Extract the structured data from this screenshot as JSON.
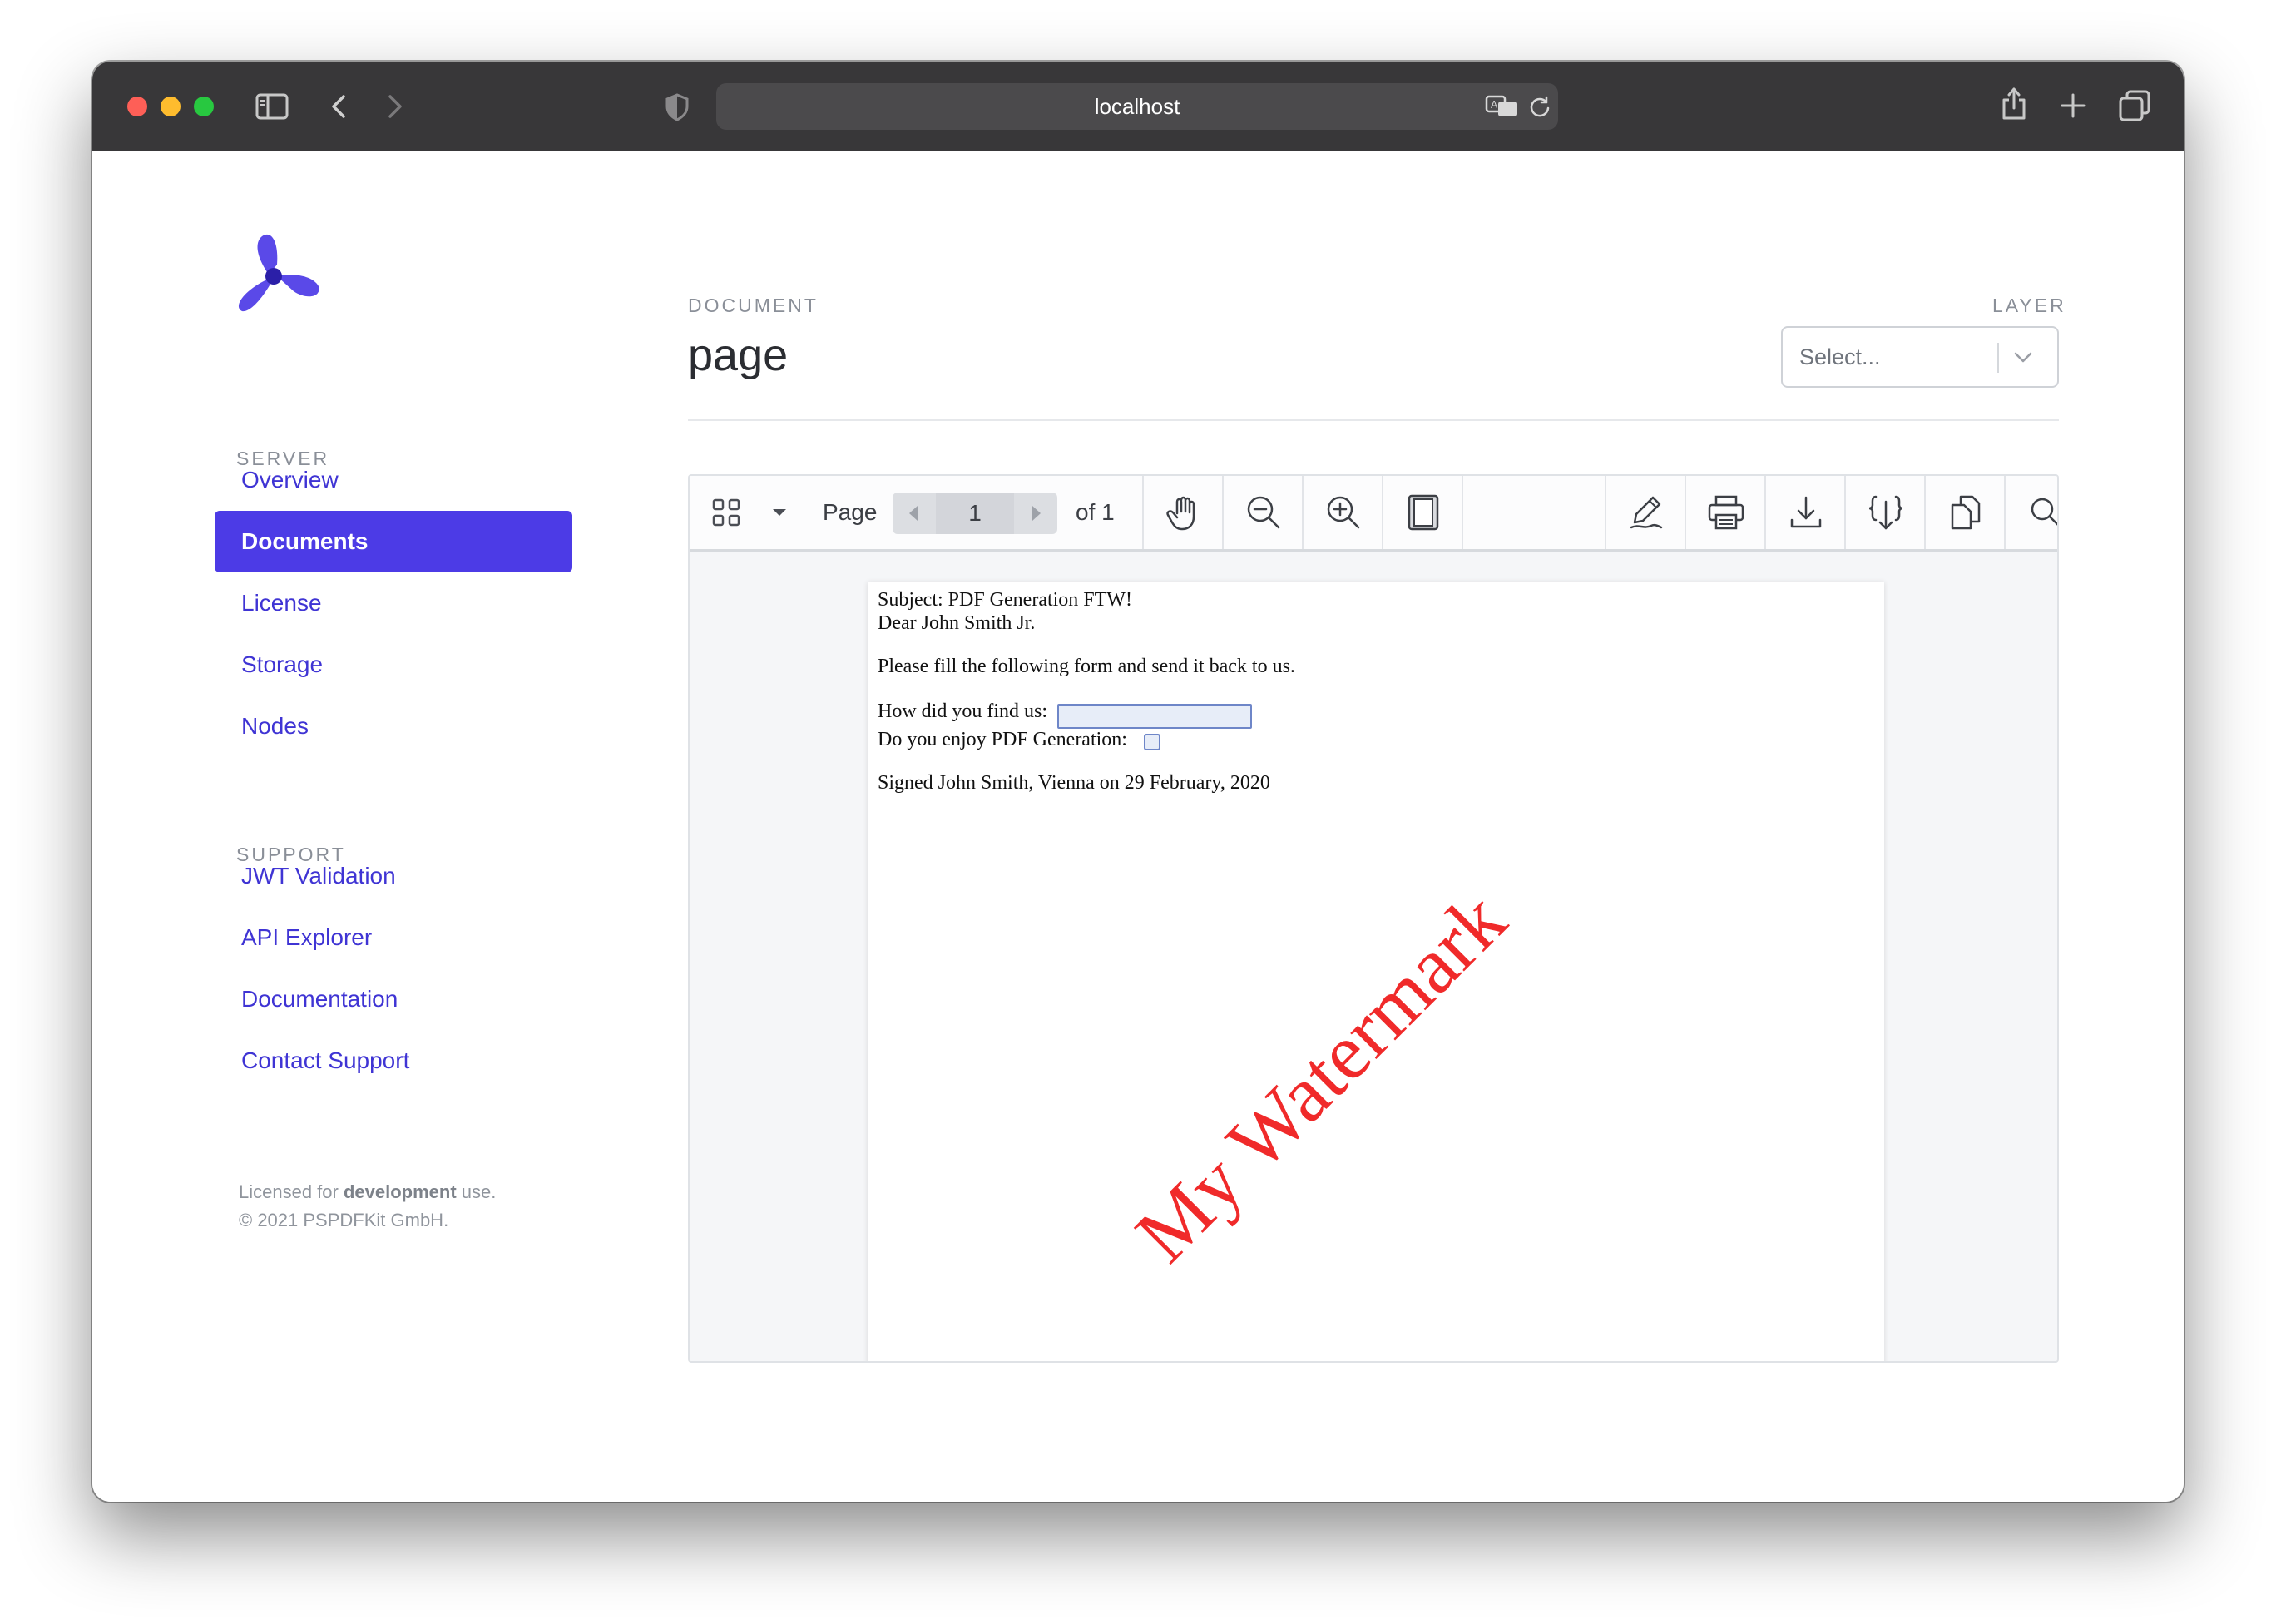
{
  "browser": {
    "url": "localhost"
  },
  "sidebar": {
    "server_label": "SERVER",
    "server_items": [
      {
        "label": "Overview"
      },
      {
        "label": "Documents"
      },
      {
        "label": "License"
      },
      {
        "label": "Storage"
      },
      {
        "label": "Nodes"
      }
    ],
    "support_label": "SUPPORT",
    "support_items": [
      {
        "label": "JWT Validation"
      },
      {
        "label": "API Explorer"
      },
      {
        "label": "Documentation"
      },
      {
        "label": "Contact Support"
      }
    ],
    "footer": {
      "line1_prefix": "Licensed for ",
      "line1_bold": "development",
      "line1_suffix": " use.",
      "line2": "© 2021 PSPDFKit GmbH."
    }
  },
  "header": {
    "document_label": "DOCUMENT",
    "title": "page",
    "layer_label": "LAYER",
    "layer_placeholder": "Select..."
  },
  "viewer": {
    "page_label": "Page",
    "current_page": "1",
    "of_label": "of 1",
    "document": {
      "line1": "Subject: PDF Generation FTW!",
      "line2": "Dear John Smith Jr.",
      "line3": "Please fill the following form and send it back to us.",
      "line4": "How did you find us:",
      "line5": "Do you enjoy PDF Generation:",
      "line6": "Signed John Smith, Vienna on 29 February, 2020",
      "watermark": "My Watermark"
    }
  },
  "colors": {
    "accent": "#4c3be6",
    "link": "#3f34d4",
    "watermark": "#f02a2a",
    "titlebar": "#383739"
  }
}
